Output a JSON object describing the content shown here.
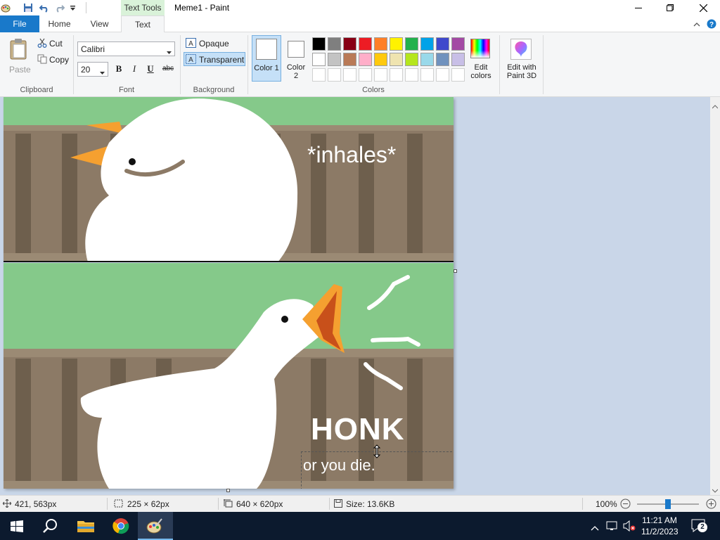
{
  "titlebar": {
    "context_tab": "Text Tools",
    "title": "Meme1 - Paint"
  },
  "tabs": {
    "file": "File",
    "home": "Home",
    "view": "View",
    "text": "Text"
  },
  "clipboard": {
    "paste": "Paste",
    "cut": "Cut",
    "copy": "Copy",
    "label": "Clipboard"
  },
  "font": {
    "family": "Calibri",
    "size": "20",
    "label": "Font",
    "bold": "B",
    "italic": "I",
    "underline": "U",
    "strike": "abc"
  },
  "background": {
    "opaque": "Opaque",
    "transparent": "Transparent",
    "label": "Background"
  },
  "colors": {
    "color1": "Color 1",
    "color2": "Color 2",
    "label": "Colors",
    "edit": "Edit colors",
    "paint3d": "Edit with Paint 3D",
    "row1": [
      "#000000",
      "#7f7f7f",
      "#880015",
      "#ed1c24",
      "#ff7f27",
      "#fff200",
      "#22b14c",
      "#00a2e8",
      "#3f48cc",
      "#a349a4"
    ],
    "row2": [
      "#ffffff",
      "#c3c3c3",
      "#b97a57",
      "#ffaec9",
      "#ffc90e",
      "#efe4b0",
      "#b5e61d",
      "#99d9ea",
      "#7092be",
      "#c8bfe7"
    ],
    "row3": [
      "#ffffff",
      "#ffffff",
      "#ffffff",
      "#ffffff",
      "#ffffff",
      "#ffffff",
      "#ffffff",
      "#ffffff",
      "#ffffff",
      "#ffffff"
    ]
  },
  "meme": {
    "top_text": "*inhales*",
    "honk_text": "HONK",
    "sub_text": "or you die."
  },
  "status": {
    "cursor": "421, 563px",
    "selection": "225 × 62px",
    "canvas_size": "640 × 620px",
    "file_size": "Size: 13.6KB",
    "zoom": "100%"
  },
  "taskbar": {
    "time": "11:21 AM",
    "date": "11/2/2023",
    "notifications": "2"
  }
}
